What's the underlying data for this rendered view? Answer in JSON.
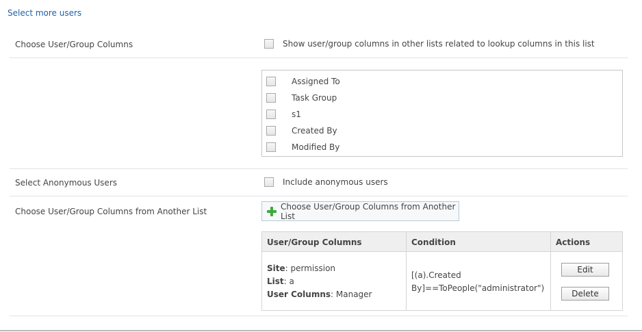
{
  "header": {
    "select_more_users": "Select more users"
  },
  "sections": {
    "user_group_columns": {
      "label": "Choose User/Group Columns",
      "related_option": "Show user/group columns in other lists related to lookup columns in this list",
      "columns": [
        "Assigned To",
        "Task Group",
        "s1",
        "Created By",
        "Modified By"
      ]
    },
    "anonymous": {
      "label": "Select Anonymous Users",
      "option": "Include anonymous users"
    },
    "another_list": {
      "label": "Choose User/Group Columns from Another List",
      "add_button": "Choose User/Group Columns from Another List",
      "table": {
        "headers": {
          "columns": "User/Group Columns",
          "condition": "Condition",
          "actions": "Actions"
        },
        "rows": [
          {
            "site_label": "Site",
            "site_value": "permission",
            "list_label": "List",
            "list_value": "a",
            "user_columns_label": "User Columns",
            "user_columns_value": "Manager",
            "condition_line1": "[(a).Created",
            "condition_line2": "By]==ToPeople(\"administrator\")",
            "edit_label": "Edit",
            "delete_label": "Delete"
          }
        ]
      }
    }
  },
  "colors": {
    "link": "#1f5fa8",
    "plus_icon": "#3caa3c",
    "table_header_bg": "#efefef"
  }
}
